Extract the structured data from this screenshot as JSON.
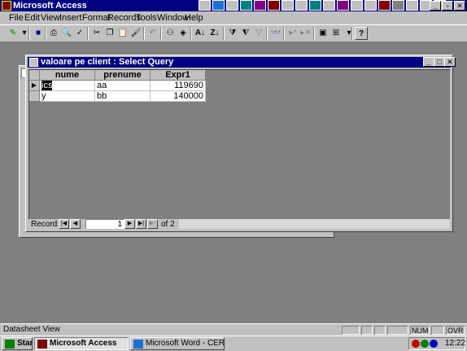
{
  "app": {
    "title": "Microsoft Access"
  },
  "menu": [
    "File",
    "Edit",
    "View",
    "Insert",
    "Format",
    "Records",
    "Tools",
    "Window",
    "Help"
  ],
  "query_window": {
    "title": "valoare pe client : Select Query",
    "columns": [
      "nume",
      "prenume",
      "Expr1"
    ],
    "rows": [
      {
        "nume": "ics",
        "prenume": "aa",
        "expr1": "119690"
      },
      {
        "nume": "y",
        "prenume": "bb",
        "expr1": "140000"
      }
    ],
    "record_label": "Record:",
    "current_record": "1",
    "of_label": "of",
    "total_records": "2"
  },
  "status": {
    "text": "Datasheet View",
    "num": "NUM",
    "ovr": "OVR"
  },
  "taskbar": {
    "start": "Start",
    "tasks": [
      "Microsoft Access",
      "Microsoft Word - CERERE..."
    ],
    "clock": "12:22"
  },
  "colors": {
    "title_active": "#000080",
    "face": "#c0c0c0",
    "desktop": "#808080"
  }
}
